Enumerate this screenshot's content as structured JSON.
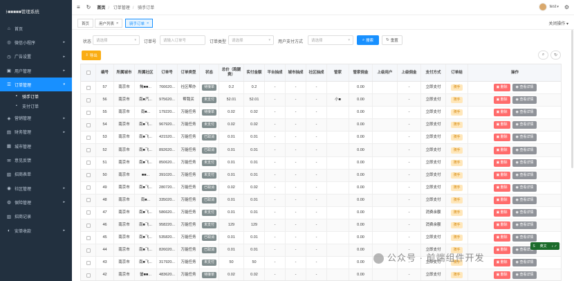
{
  "app": {
    "logo_text": "ﾄ■■■■■管理系统"
  },
  "sidebar": {
    "items": [
      {
        "icon": "⌂",
        "icon_name": "home-icon",
        "label": "首页",
        "arrow": ""
      },
      {
        "icon": "◎",
        "icon_name": "miniprogram-icon",
        "label": "微信小程序",
        "arrow": "▸"
      },
      {
        "icon": "◷",
        "icon_name": "ad-icon",
        "label": "广告设置",
        "arrow": "▸"
      },
      {
        "icon": "▣",
        "icon_name": "user-icon",
        "label": "用户管理",
        "arrow": "▸"
      },
      {
        "icon": "☰",
        "icon_name": "order-icon",
        "label": "订单管理",
        "arrow": "▾",
        "active": true
      }
    ],
    "sub_items": [
      {
        "icon": "▪",
        "icon_name": "rider-order-icon",
        "label": "骑手订单",
        "active": true
      },
      {
        "icon": "▪",
        "icon_name": "pay-order-icon",
        "label": "支付订单",
        "active": false
      }
    ],
    "items2": [
      {
        "icon": "◈",
        "icon_name": "marketing-icon",
        "label": "营销管理",
        "arrow": "▸"
      },
      {
        "icon": "▤",
        "icon_name": "finance-icon",
        "label": "财务管理",
        "arrow": "▸"
      },
      {
        "icon": "▦",
        "icon_name": "city-icon",
        "label": "城市管理",
        "arrow": ""
      },
      {
        "icon": "✉",
        "icon_name": "feedback-icon",
        "label": "意见反馈",
        "arrow": ""
      },
      {
        "icon": "▧",
        "icon_name": "recruit-icon",
        "label": "招商表单",
        "arrow": ""
      },
      {
        "icon": "◉",
        "icon_name": "community-icon",
        "label": "社区管理",
        "arrow": "▸"
      },
      {
        "icon": "◍",
        "icon_name": "insurance-icon",
        "label": "保险管理",
        "arrow": "▸"
      },
      {
        "icon": "▥",
        "icon_name": "recruit-record-icon",
        "label": "招商记录",
        "arrow": ""
      },
      {
        "icon": "◐",
        "icon_name": "security-icon",
        "label": "安单收款",
        "arrow": "▸"
      }
    ]
  },
  "topbar": {
    "breadcrumb": [
      "首页",
      "订单管理",
      "骑手订单"
    ],
    "user": "test",
    "menu_icon": "≡",
    "refresh_icon": "↻",
    "settings_icon": "⚙"
  },
  "tabs": [
    {
      "label": "首页",
      "closable": false
    },
    {
      "label": "用户列表",
      "closable": true
    },
    {
      "label": "骑手订单",
      "closable": true,
      "active": true
    }
  ],
  "close_ops": "关闭操作 ▾",
  "filters": {
    "status_label": "状态",
    "status_placeholder": "请选择",
    "order_no_label": "订单号",
    "order_no_placeholder": "请输入订单号",
    "order_type_label": "订单类型",
    "order_type_placeholder": "请选择",
    "pay_method_label": "用户支付方式",
    "pay_method_placeholder": "请选择",
    "search_label": "搜索",
    "reset_label": "重置",
    "export_label": "导出"
  },
  "table": {
    "headers": [
      "",
      "编号",
      "所属城市",
      "所属社区",
      "订单号",
      "订单类型",
      "状态",
      "总价（跑腿费）",
      "实付金额",
      "平台抽成",
      "城市抽成",
      "社区抽成",
      "管家",
      "管家佣金",
      "上级用户",
      "上级佣金",
      "支付方式",
      "订单结",
      "操作"
    ],
    "delete_label": "删除",
    "view_label": "查看详情",
    "rows": [
      {
        "id": "57",
        "city": "南京市",
        "community": "鮪■■...",
        "order_no": "766620...",
        "type": "社区帮办",
        "status": "待接单",
        "total": "0.2",
        "paid": "0.2",
        "platform": "-",
        "city_cut": "-",
        "comm_cut": "-",
        "steward": "",
        "steward_fee": "0.00",
        "parent": "",
        "parent_fee": "-",
        "pay": "立即支付",
        "settle": "骑手"
      },
      {
        "id": "56",
        "city": "南京市",
        "community": "南■汽...",
        "order_no": "975620...",
        "type": "帮我买",
        "status": "未支付",
        "total": "52.01",
        "paid": "52.01",
        "platform": "-",
        "city_cut": "-",
        "comm_cut": "-",
        "steward": "小■",
        "steward_fee": "0.00",
        "parent": "",
        "parent_fee": "-",
        "pay": "立即支付",
        "settle": "骑手"
      },
      {
        "id": "55",
        "city": "南京市",
        "community": "南■...",
        "order_no": "179220...",
        "type": "万能任务",
        "status": "待接单",
        "total": "0.02",
        "paid": "0.02",
        "platform": "-",
        "city_cut": "-",
        "comm_cut": "-",
        "steward": "",
        "steward_fee": "0.00",
        "parent": "",
        "parent_fee": "-",
        "pay": "立即支付",
        "settle": "骑手"
      },
      {
        "id": "54",
        "city": "南京市",
        "community": "南■飞...",
        "order_no": "967920...",
        "type": "万能任务",
        "status": "未支付",
        "total": "0.02",
        "paid": "0.02",
        "platform": "-",
        "city_cut": "-",
        "comm_cut": "-",
        "steward": "",
        "steward_fee": "0.00",
        "parent": "",
        "parent_fee": "-",
        "pay": "立即支付",
        "settle": "骑手"
      },
      {
        "id": "53",
        "city": "南京市",
        "community": "南■飞...",
        "order_no": "421520...",
        "type": "万能任务",
        "status": "已取消",
        "total": "0.01",
        "paid": "0.01",
        "platform": "-",
        "city_cut": "-",
        "comm_cut": "-",
        "steward": "",
        "steward_fee": "0.00",
        "parent": "",
        "parent_fee": "-",
        "pay": "立即支付",
        "settle": "骑手"
      },
      {
        "id": "52",
        "city": "南京市",
        "community": "南■飞...",
        "order_no": "892620...",
        "type": "万能任务",
        "status": "已取消",
        "total": "0.01",
        "paid": "0.01",
        "platform": "-",
        "city_cut": "-",
        "comm_cut": "-",
        "steward": "",
        "steward_fee": "0.00",
        "parent": "",
        "parent_fee": "-",
        "pay": "立即支付",
        "settle": "骑手"
      },
      {
        "id": "51",
        "city": "南京市",
        "community": "南■飞...",
        "order_no": "850620...",
        "type": "万能任务",
        "status": "未支付",
        "total": "0.01",
        "paid": "0.01",
        "platform": "-",
        "city_cut": "-",
        "comm_cut": "-",
        "steward": "",
        "steward_fee": "0.00",
        "parent": "",
        "parent_fee": "-",
        "pay": "立即支付",
        "settle": "骑手"
      },
      {
        "id": "50",
        "city": "南京市",
        "community": "■■...",
        "order_no": "391020...",
        "type": "万能任务",
        "status": "未支付",
        "total": "0.01",
        "paid": "0.01",
        "platform": "-",
        "city_cut": "-",
        "comm_cut": "-",
        "steward": "",
        "steward_fee": "0.00",
        "parent": "",
        "parent_fee": "-",
        "pay": "立即支付",
        "settle": "骑手"
      },
      {
        "id": "49",
        "city": "南京市",
        "community": "南■飞...",
        "order_no": "280720...",
        "type": "万能任务",
        "status": "已取消",
        "total": "0.02",
        "paid": "0.02",
        "platform": "-",
        "city_cut": "-",
        "comm_cut": "-",
        "steward": "",
        "steward_fee": "0.00",
        "parent": "",
        "parent_fee": "-",
        "pay": "立即支付",
        "settle": "骑手"
      },
      {
        "id": "48",
        "city": "南京市",
        "community": "南■...",
        "order_no": "335020...",
        "type": "万能任务",
        "status": "已取消",
        "total": "0.01",
        "paid": "0.01",
        "platform": "-",
        "city_cut": "-",
        "comm_cut": "-",
        "steward": "",
        "steward_fee": "0.00",
        "parent": "",
        "parent_fee": "-",
        "pay": "立即支付",
        "settle": "骑手"
      },
      {
        "id": "47",
        "city": "南京市",
        "community": "南■飞...",
        "order_no": "586620...",
        "type": "万能任务",
        "status": "未支付",
        "total": "0.01",
        "paid": "0.01",
        "platform": "-",
        "city_cut": "-",
        "comm_cut": "-",
        "steward": "",
        "steward_fee": "0.00",
        "parent": "",
        "parent_fee": "-",
        "pay": "消费余额",
        "settle": "骑手"
      },
      {
        "id": "46",
        "city": "南京市",
        "community": "南■飞...",
        "order_no": "958220...",
        "type": "万能任务",
        "status": "未支付",
        "total": "129",
        "paid": "129",
        "platform": "-",
        "city_cut": "-",
        "comm_cut": "-",
        "steward": "",
        "steward_fee": "0.00",
        "parent": "",
        "parent_fee": "-",
        "pay": "消费余额",
        "settle": "骑手"
      },
      {
        "id": "45",
        "city": "南京市",
        "community": "南■飞...",
        "order_no": "535820...",
        "type": "万能任务",
        "status": "已取消",
        "total": "0.01",
        "paid": "0.01",
        "platform": "-",
        "city_cut": "-",
        "comm_cut": "-",
        "steward": "",
        "steward_fee": "0.00",
        "parent": "",
        "parent_fee": "-",
        "pay": "立即支付",
        "settle": "骑手"
      },
      {
        "id": "44",
        "city": "南京市",
        "community": "南■飞...",
        "order_no": "826020...",
        "type": "万能任务",
        "status": "已取消",
        "total": "0.01",
        "paid": "0.01",
        "platform": "-",
        "city_cut": "-",
        "comm_cut": "-",
        "steward": "",
        "steward_fee": "0.00",
        "parent": "",
        "parent_fee": "-",
        "pay": "立即支付",
        "settle": "骑手"
      },
      {
        "id": "43",
        "city": "南京市",
        "community": "南■飞...",
        "order_no": "317920...",
        "type": "万能任务",
        "status": "未支付",
        "total": "50",
        "paid": "50",
        "platform": "-",
        "city_cut": "-",
        "comm_cut": "-",
        "steward": "",
        "steward_fee": "0.00",
        "parent": "",
        "parent_fee": "-",
        "pay": "立即支付",
        "settle": "骑手"
      },
      {
        "id": "42",
        "city": "南京市",
        "community": "鎣■■...",
        "order_no": "483620...",
        "type": "万能任务",
        "status": "待接单",
        "total": "0.02",
        "paid": "0.02",
        "platform": "-",
        "city_cut": "-",
        "comm_cut": "-",
        "steward": "",
        "steward_fee": "0.00",
        "parent": "",
        "parent_fee": "-",
        "pay": "立即支付",
        "settle": "骑手"
      }
    ]
  },
  "watermark": "公众号 · 前端组件开发",
  "ime_badge": {
    "left": "S",
    "text": "英文",
    "right": "♪ ✓"
  },
  "colors": {
    "sidebar_bg": "#22303f",
    "accent": "#1890ff",
    "status_tag": "#7f8c8d",
    "delete": "#ff6b6b",
    "view": "#909399",
    "export": "#faad14"
  }
}
